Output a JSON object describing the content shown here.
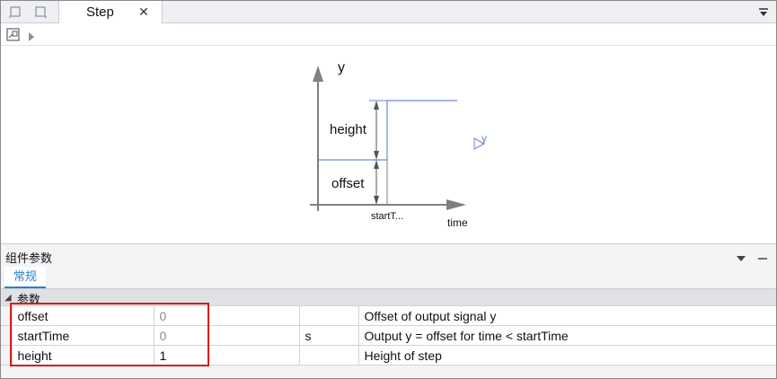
{
  "tab_bar": {
    "tabs": [
      {
        "label": "Step",
        "close_glyph": "✕",
        "active": true
      }
    ],
    "left_icons": [
      "pin-icon",
      "window-icon"
    ],
    "menu_icon": "chevron-down-icon"
  },
  "toolbar": {
    "icons": [
      "diagram-view-icon",
      "play-arrow-icon"
    ]
  },
  "diagram": {
    "y_axis_label": "y",
    "x_axis_label": "time",
    "height_label": "height",
    "offset_label": "offset",
    "start_label": "startT...",
    "output_port_label": "y",
    "accent_color": "#6f86d6"
  },
  "panel": {
    "title": "组件参数",
    "subtab": "常规",
    "group": "参数",
    "params": [
      {
        "name": "offset",
        "value": "0",
        "unit": "",
        "description": "Offset of output signal y",
        "is_default": true
      },
      {
        "name": "startTime",
        "value": "0",
        "unit": "s",
        "description": "Output y = offset for time < startTime",
        "is_default": true
      },
      {
        "name": "height",
        "value": "1",
        "unit": "",
        "description": "Height of step",
        "is_default": false
      }
    ],
    "highlight_color": "#e0161d"
  }
}
